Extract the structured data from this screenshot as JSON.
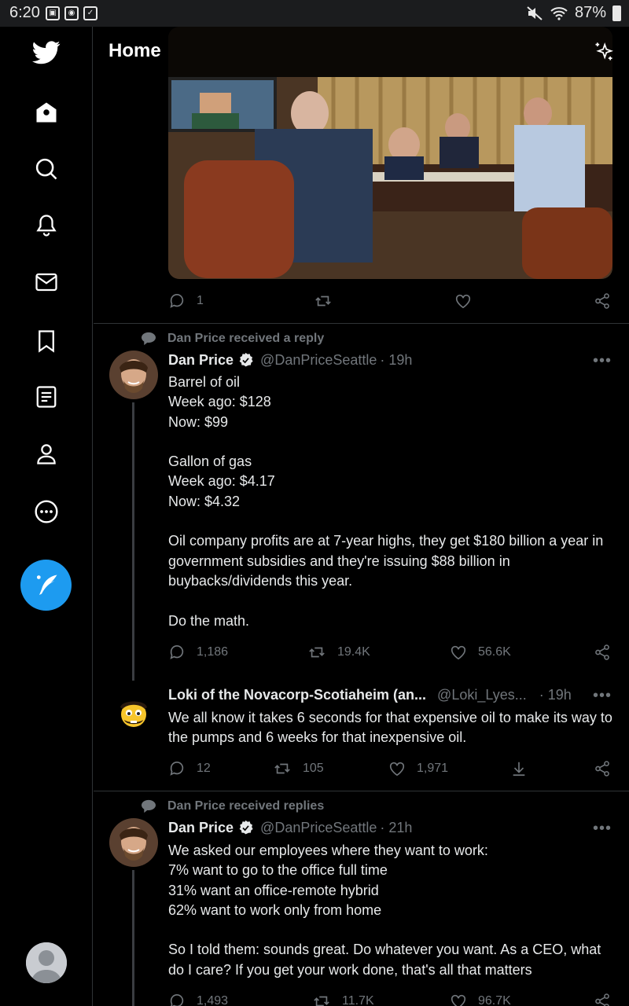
{
  "status_bar": {
    "time": "6:20",
    "battery": "87%"
  },
  "header": {
    "title": "Home"
  },
  "top_tweet": {
    "actions": {
      "replies": "1",
      "retweets": "",
      "likes": ""
    }
  },
  "tweet1": {
    "context": "Dan Price received a reply",
    "name": "Dan Price",
    "handle": "@DanPriceSeattle",
    "time": "· 19h",
    "body": "Barrel of oil\nWeek ago: $128\nNow: $99\n\nGallon of gas\nWeek ago: $4.17\nNow: $4.32\n\nOil company profits are at 7-year highs, they get $180 billion a year in government subsidies and they're issuing $88 billion in buybacks/dividends this year.\n\nDo the math.",
    "actions": {
      "replies": "1,186",
      "retweets": "19.4K",
      "likes": "56.6K"
    }
  },
  "reply1": {
    "name": "Loki of the Novacorp-Scotiaheim (an...",
    "handle": "@Loki_Lyes...",
    "time": "· 19h",
    "body": "We all know it takes 6 seconds for that expensive oil to make its way to the pumps and 6 weeks for that inexpensive oil.",
    "actions": {
      "replies": "12",
      "retweets": "105",
      "likes": "1,971"
    }
  },
  "tweet2": {
    "context": "Dan Price received replies",
    "name": "Dan Price",
    "handle": "@DanPriceSeattle",
    "time": "· 21h",
    "body": "We asked our employees where they want to work:\n7% want to go to the office full time\n31% want an office-remote hybrid\n62% want to work only from home\n\nSo I told them: sounds great. Do whatever you want. As a CEO, what do I care? If you get your work done, that's all that matters",
    "actions": {
      "replies": "1,493",
      "retweets": "11.7K",
      "likes": "96.7K"
    }
  },
  "colors": {
    "accent": "#1d9bf0",
    "muted": "#71767b",
    "background": "#000000",
    "divider": "#2f3336"
  },
  "icons": [
    "twitter-logo-icon",
    "home-icon",
    "search-icon",
    "bell-icon",
    "mail-icon",
    "bookmark-icon",
    "lists-icon",
    "profile-icon",
    "more-circle-icon",
    "compose-icon",
    "sparkle-icon",
    "reply-icon",
    "retweet-icon",
    "like-icon",
    "share-icon",
    "download-icon",
    "verified-icon"
  ]
}
